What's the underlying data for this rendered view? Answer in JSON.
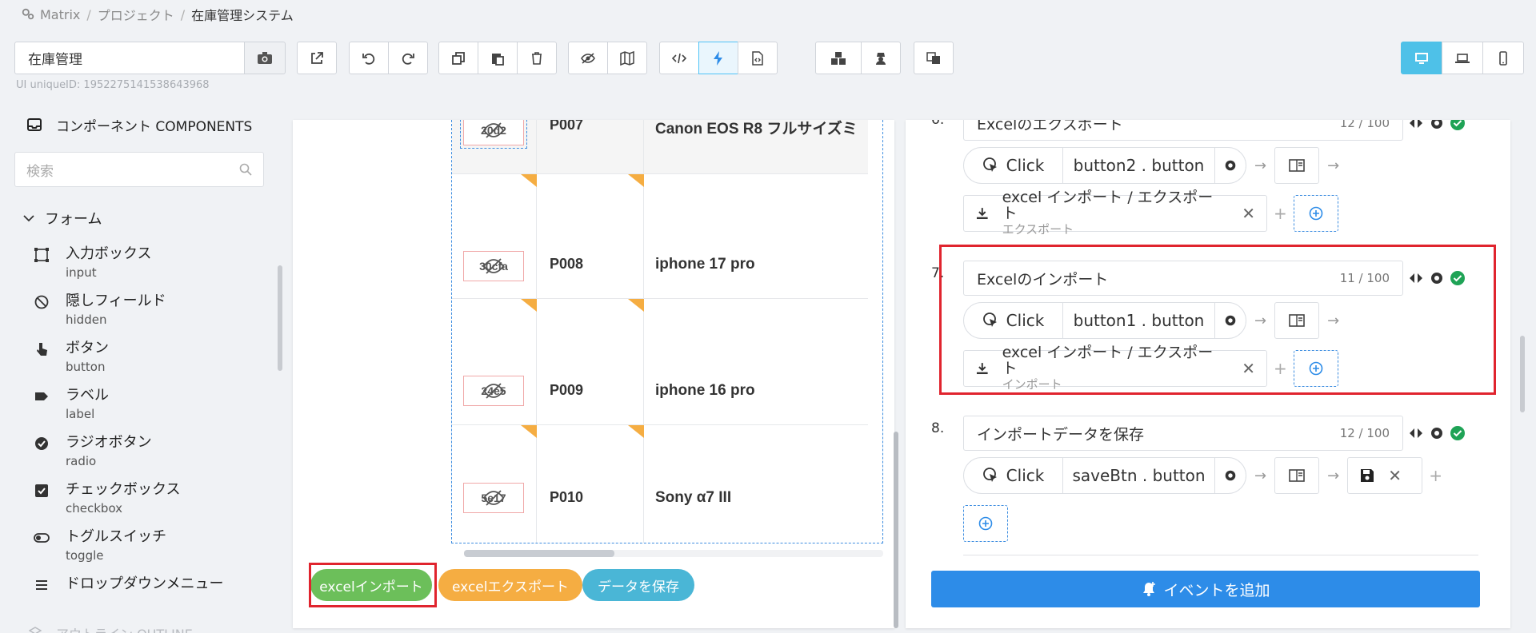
{
  "breadcrumb": {
    "items": [
      "Matrix",
      "プロジェクト",
      "在庫管理システム"
    ],
    "sep": "/"
  },
  "toolbar": {
    "page_name": "在庫管理",
    "uid": "UI uniqueID: 1952275141538643968"
  },
  "sidebar": {
    "components_title": "コンポーネント COMPONENTS",
    "search_placeholder": "検索",
    "form_group": "フォーム",
    "items": [
      {
        "jp": "入力ボックス",
        "en": "input",
        "icon": "input-icon"
      },
      {
        "jp": "隠しフィールド",
        "en": "hidden",
        "icon": "hidden-icon"
      },
      {
        "jp": "ボタン",
        "en": "button",
        "icon": "pointer-icon"
      },
      {
        "jp": "ラベル",
        "en": "label",
        "icon": "tag-icon"
      },
      {
        "jp": "ラジオボタン",
        "en": "radio",
        "icon": "radio-icon"
      },
      {
        "jp": "チェックボックス",
        "en": "checkbox",
        "icon": "checkbox-icon"
      },
      {
        "jp": "トグルスイッチ",
        "en": "toggle",
        "icon": "toggle-icon"
      },
      {
        "jp": "ドロップダウンメニュー",
        "en": "",
        "icon": "list-icon"
      }
    ],
    "outline_title": "アウトライン OUTLINE"
  },
  "table": {
    "rows": [
      {
        "img": "20d2",
        "code": "P007",
        "name": "Canon EOS R8 フルサイズミ"
      },
      {
        "img": "30cfa",
        "code": "P008",
        "name": "iphone 17 pro"
      },
      {
        "img": "24e5",
        "code": "P009",
        "name": "iphone 16 pro"
      },
      {
        "img": "5e17",
        "code": "P010",
        "name": "Sony α7 III"
      }
    ]
  },
  "canvas_buttons": {
    "import": "excelインポート",
    "export": "excelエクスポート",
    "save": "データを保存"
  },
  "events": [
    {
      "num": "6.",
      "title": "Excelのエクスポート",
      "count": "12 / 100",
      "trigger": "Click",
      "target": "button2 . button",
      "action_main": "excel インポート / エクスポート",
      "action_sub": "エクスポート"
    },
    {
      "num": "7.",
      "title": "Excelのインポート",
      "count": "11 / 100",
      "trigger": "Click",
      "target": "button1 . button",
      "action_main": "excel インポート / エクスポート",
      "action_sub": "インポート"
    },
    {
      "num": "8.",
      "title": "インポートデータを保存",
      "count": "12 / 100",
      "trigger": "Click",
      "target": "saveBtn . button"
    }
  ],
  "add_event_label": "イベントを追加",
  "colors": {
    "import_btn": "#6cbf5a",
    "export_btn": "#f5ad42",
    "save_btn": "#4ab6d6",
    "accent": "#2d8ce8",
    "highlight": "#e0242e",
    "ok_green": "#1fa356"
  }
}
